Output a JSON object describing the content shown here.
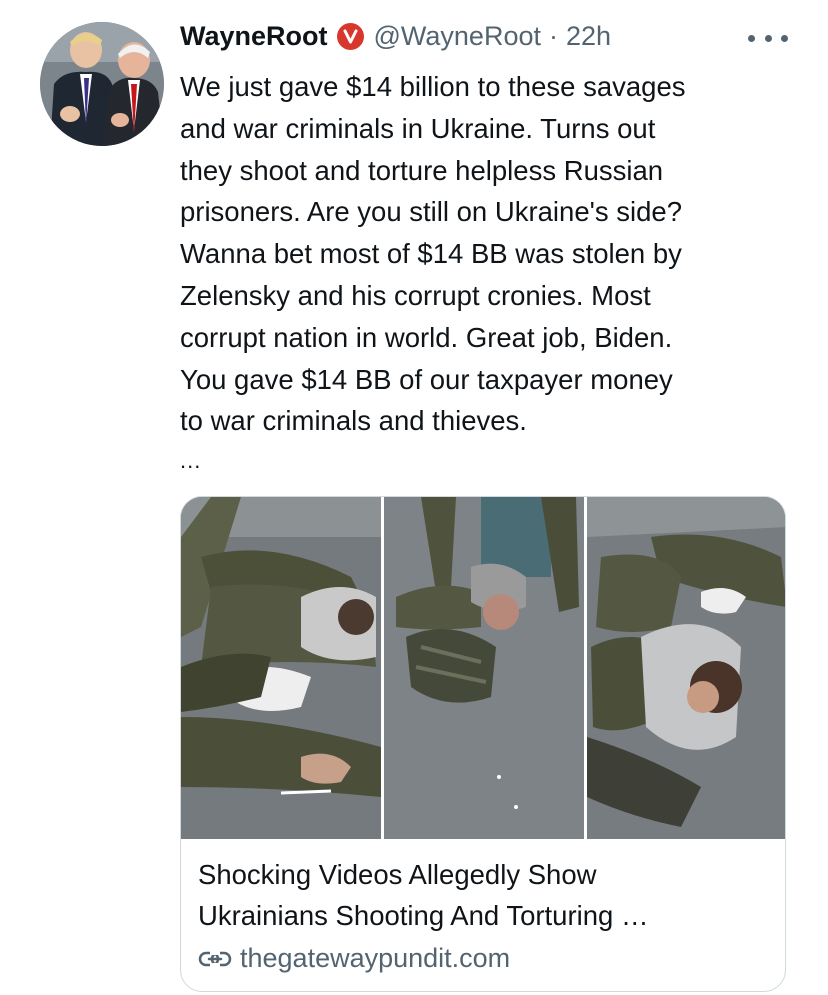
{
  "tweet": {
    "author": {
      "display_name": "WayneRoot",
      "handle": "@WayneRoot",
      "verified_badge": "V"
    },
    "timestamp": "22h",
    "separator": "·",
    "text_lines": [
      "We just gave $14 billion to these savages",
      "and war criminals in Ukraine. Turns out",
      "they shoot and torture helpless Russian",
      "prisoners. Are you still on Ukraine's side?",
      "Wanna bet most of $14 BB was stolen by",
      "Zelensky and his corrupt cronies. Most",
      "corrupt nation in world. Great job, Biden.",
      "You gave $14 BB of our taxpayer money",
      "to war criminals and thieves."
    ],
    "truncation": "...",
    "link_card": {
      "title_lines": [
        "Shocking Videos Allegedly Show",
        "Ukrainians Shooting And Torturing …"
      ],
      "domain": "thegatewaypundit.com"
    }
  },
  "icons": {
    "more": "more-horizontal-icon",
    "verified": "verified-badge-icon",
    "link": "link-icon"
  },
  "colors": {
    "text": "#0f1419",
    "secondary": "#536471",
    "badge": "#d8372d",
    "border": "#cfd9de"
  }
}
